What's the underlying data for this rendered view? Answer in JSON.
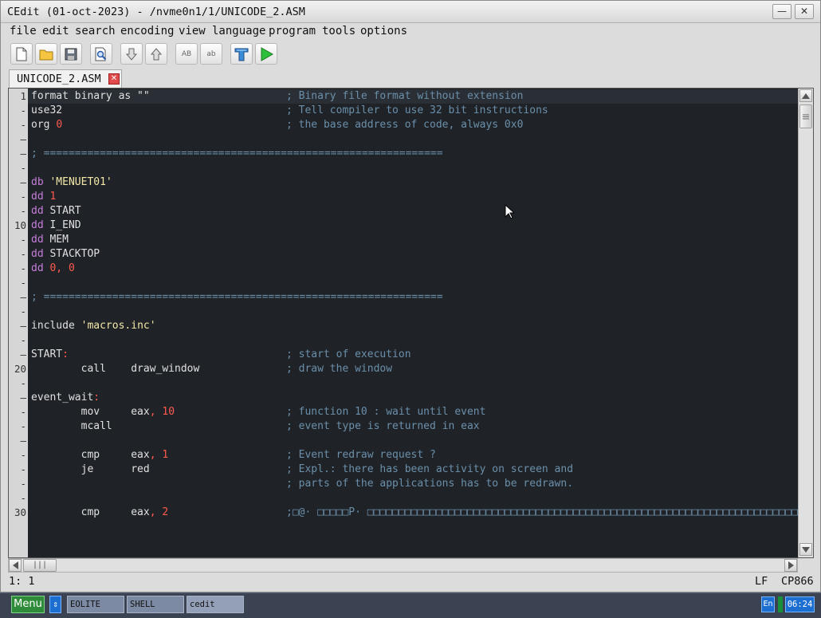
{
  "window": {
    "title": "CEdit (01-oct-2023) - /nvme0n1/1/UNICODE_2.ASM",
    "minimize_glyph": "—",
    "close_glyph": "✕"
  },
  "menu": [
    "file",
    "edit",
    "search",
    "encoding",
    "view",
    "language",
    "program",
    "tools",
    "options"
  ],
  "toolbar": {
    "buttons": [
      {
        "name": "new-file-icon"
      },
      {
        "name": "open-folder-icon"
      },
      {
        "name": "save-icon"
      },
      {
        "name": "find-icon"
      },
      {
        "name": "arrow-down-icon"
      },
      {
        "name": "arrow-up-icon"
      },
      {
        "name": "uppercase-icon",
        "text": "AB"
      },
      {
        "name": "lowercase-icon",
        "text": "ab"
      },
      {
        "name": "compile-icon"
      },
      {
        "name": "run-icon"
      }
    ]
  },
  "tab": {
    "label": "UNICODE_2.ASM",
    "close_glyph": "✕"
  },
  "editor": {
    "lines": [
      {
        "ln": "1",
        "instr": [
          {
            "t": "format binary as \"\"",
            "c": "kw"
          }
        ],
        "cmt": "; Binary file format without extension"
      },
      {
        "ln": "-",
        "instr": [
          {
            "t": "use32",
            "c": "kw"
          }
        ],
        "cmt": "; Tell compiler to use 32 bit instructions"
      },
      {
        "ln": "-",
        "instr": [
          {
            "t": "org ",
            "c": "kw"
          },
          {
            "t": "0",
            "c": "num"
          }
        ],
        "cmt": "; the base address of code, always 0x0"
      },
      {
        "ln": "—",
        "instr": [],
        "cmt": ""
      },
      {
        "ln": "—",
        "instr": [
          {
            "t": "; ================================================================",
            "c": "cmt"
          }
        ],
        "cmt": ""
      },
      {
        "ln": "-",
        "instr": [],
        "cmt": ""
      },
      {
        "ln": "—",
        "instr": [
          {
            "t": "db ",
            "c": "dir"
          },
          {
            "t": "'MENUET01'",
            "c": "str"
          }
        ],
        "cmt": ""
      },
      {
        "ln": "-",
        "instr": [
          {
            "t": "dd ",
            "c": "dir"
          },
          {
            "t": "1",
            "c": "num"
          }
        ],
        "cmt": ""
      },
      {
        "ln": "-",
        "instr": [
          {
            "t": "dd ",
            "c": "dir"
          },
          {
            "t": "START",
            "c": "kw"
          }
        ],
        "cmt": ""
      },
      {
        "ln": "10",
        "instr": [
          {
            "t": "dd ",
            "c": "dir"
          },
          {
            "t": "I_END",
            "c": "kw"
          }
        ],
        "cmt": ""
      },
      {
        "ln": "-",
        "instr": [
          {
            "t": "dd ",
            "c": "dir"
          },
          {
            "t": "MEM",
            "c": "kw"
          }
        ],
        "cmt": ""
      },
      {
        "ln": "-",
        "instr": [
          {
            "t": "dd ",
            "c": "dir"
          },
          {
            "t": "STACKTOP",
            "c": "kw"
          }
        ],
        "cmt": ""
      },
      {
        "ln": "-",
        "instr": [
          {
            "t": "dd ",
            "c": "dir"
          },
          {
            "t": "0, 0",
            "c": "num"
          }
        ],
        "cmt": ""
      },
      {
        "ln": "-",
        "instr": [],
        "cmt": ""
      },
      {
        "ln": "—",
        "instr": [
          {
            "t": "; ================================================================",
            "c": "cmt"
          }
        ],
        "cmt": ""
      },
      {
        "ln": "-",
        "instr": [],
        "cmt": ""
      },
      {
        "ln": "—",
        "instr": [
          {
            "t": "include ",
            "c": "kw"
          },
          {
            "t": "'macros.inc'",
            "c": "str"
          }
        ],
        "cmt": ""
      },
      {
        "ln": "-",
        "instr": [],
        "cmt": ""
      },
      {
        "ln": "—",
        "instr": [
          {
            "t": "START",
            "c": "kw"
          },
          {
            "t": ":",
            "c": "op"
          }
        ],
        "cmt": "; start of execution"
      },
      {
        "ln": "20",
        "instr": [
          {
            "t": "        call    draw_window",
            "c": "kw"
          }
        ],
        "cmt": "; draw the window"
      },
      {
        "ln": "-",
        "instr": [],
        "cmt": ""
      },
      {
        "ln": "—",
        "instr": [
          {
            "t": "event_wait",
            "c": "kw"
          },
          {
            "t": ":",
            "c": "op"
          }
        ],
        "cmt": ""
      },
      {
        "ln": "-",
        "instr": [
          {
            "t": "        mov     eax",
            "c": "kw"
          },
          {
            "t": ", ",
            "c": "op"
          },
          {
            "t": "10",
            "c": "num"
          }
        ],
        "cmt": "; function 10 : wait until event"
      },
      {
        "ln": "-",
        "instr": [
          {
            "t": "        mcall",
            "c": "kw"
          }
        ],
        "cmt": "; event type is returned in eax"
      },
      {
        "ln": "—",
        "instr": [],
        "cmt": ""
      },
      {
        "ln": "-",
        "instr": [
          {
            "t": "        cmp     eax",
            "c": "kw"
          },
          {
            "t": ", ",
            "c": "op"
          },
          {
            "t": "1",
            "c": "num"
          }
        ],
        "cmt": "; Event redraw request ?"
      },
      {
        "ln": "-",
        "instr": [
          {
            "t": "        je      red",
            "c": "kw"
          }
        ],
        "cmt": "; Expl.: there has been activity on screen and"
      },
      {
        "ln": "-",
        "instr": [],
        "cmt": "; parts of the applications has to be redrawn."
      },
      {
        "ln": "-",
        "instr": [],
        "cmt": ""
      },
      {
        "ln": "30",
        "instr": [
          {
            "t": "        cmp     eax",
            "c": "kw"
          },
          {
            "t": ", ",
            "c": "op"
          },
          {
            "t": "2",
            "c": "num"
          }
        ],
        "cmt": ";□@· □□□□□P· □□□□□□□□□□□□□□□□□□□□□□□□□□□□□□□□□□□□□□□□□□□□□□□□□□□□□□□□□□□□□□□□□□□□□□□□"
      }
    ]
  },
  "statusbar": {
    "position": "1: 1",
    "line_ending": "LF",
    "encoding": "CP866"
  },
  "taskbar": {
    "menu_label": "Menu",
    "switch_glyph": "⇕",
    "tasks": [
      "EOLITE",
      "SHELL",
      "cedit"
    ],
    "lang": "En",
    "clock": "06:24"
  }
}
